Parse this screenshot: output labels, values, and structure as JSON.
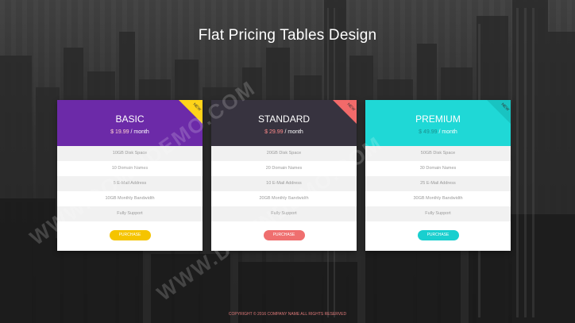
{
  "page": {
    "title": "Flat Pricing Tables Design",
    "footer": "COPYRIGHT © 2016 COMPANY NAME ALL RIGHTS RESERVED",
    "watermark": "WWW.DOWNDEMO.COM"
  },
  "colors": {
    "basic": "#6c2aa8",
    "standard": "#37333f",
    "premium": "#1fd8d6",
    "ribbon_basic": "#ffd319",
    "ribbon_standard": "#f26a6a",
    "ribbon_premium": "#19c3c1",
    "btn_basic": "#f5c400",
    "btn_standard": "#ef6f6f",
    "btn_premium": "#19cfcf"
  },
  "plans": [
    {
      "name": "BASIC",
      "price": "$ 19.99",
      "period": "/ month",
      "ribbon": "NEW",
      "features": [
        "10GB Disk Space",
        "10 Domain Names",
        "5 E-Mail Address",
        "10GB Monthly Bandwidth",
        "Fully Support"
      ],
      "button": "PURCHASE"
    },
    {
      "name": "STANDARD",
      "price": "$ 29.99",
      "period": "/ month",
      "ribbon": "NEW",
      "features": [
        "20GB Disk Space",
        "20 Domain Names",
        "10 E-Mail Address",
        "20GB Monthly Bandwidth",
        "Fully Support"
      ],
      "button": "PURCHASE"
    },
    {
      "name": "PREMIUM",
      "price": "$ 49.99",
      "period": "/ month",
      "ribbon": "NEW",
      "features": [
        "50GB Disk Space",
        "30 Domain Names",
        "25 E-Mail Address",
        "30GB Monthly Bandwidth",
        "Fully Support"
      ],
      "button": "PURCHASE"
    }
  ]
}
